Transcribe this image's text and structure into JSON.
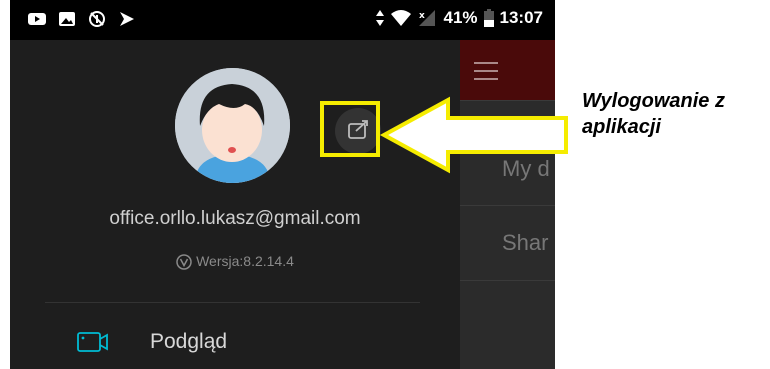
{
  "status_bar": {
    "battery": "41%",
    "time": "13:07",
    "icons": [
      "youtube-icon",
      "gallery-icon",
      "data-saver-icon",
      "notification-icon",
      "signal-arrows-icon",
      "wifi-icon",
      "no-signal-icon",
      "battery-icon"
    ]
  },
  "drawer": {
    "email": "office.orllo.lukasz@gmail.com",
    "version": "Wersja:8.2.14.4",
    "menu": [
      {
        "label": "Podgląd",
        "icon": "camera-icon"
      }
    ],
    "logout_icon": "logout-icon",
    "accent": "#00bcd4"
  },
  "background_app": {
    "rows": [
      "My d",
      "Shar"
    ],
    "bar_color": "#4a0a0a"
  },
  "annotation": {
    "line1": "Wylogowanie z",
    "line2": "aplikacji",
    "highlight_color": "#f5ec00"
  }
}
